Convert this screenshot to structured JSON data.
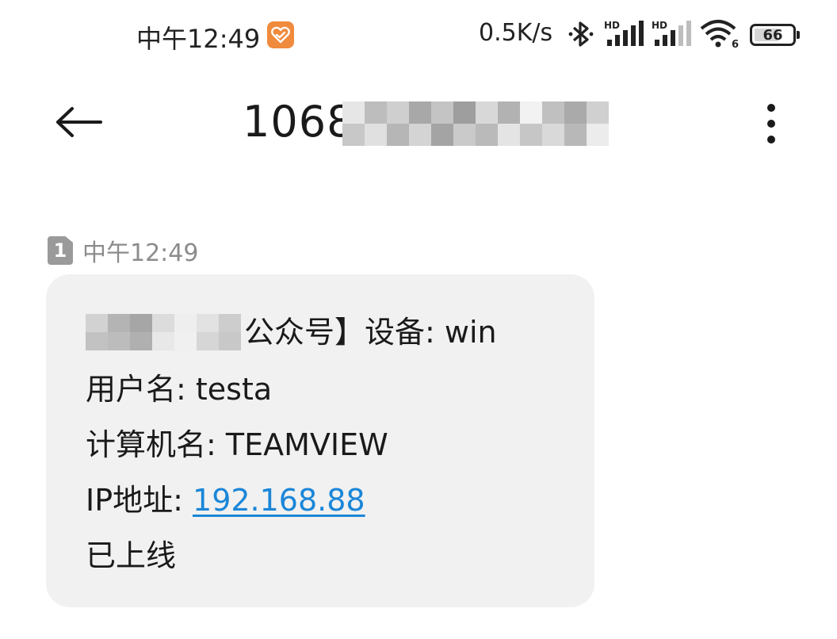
{
  "status_bar": {
    "time": "中午12:49",
    "net_speed": "0.5K/s",
    "signal_1_label": "HD",
    "signal_2_label": "HD",
    "wifi_label": "6",
    "battery": "66"
  },
  "header": {
    "title": "1068"
  },
  "message": {
    "sim_slot": "1",
    "time": "中午12:49",
    "line1": "公众号】设备: win",
    "line2": "用户名: testa",
    "line3": "计算机名: TEAMVIEW",
    "line4_label": "IP地址: ",
    "line4_link": "192.168.88",
    "line5": "已上线"
  },
  "colors": {
    "link": "#1a86d8",
    "bubble": "#f1f1f1",
    "app_badge": "#f08a3c"
  }
}
